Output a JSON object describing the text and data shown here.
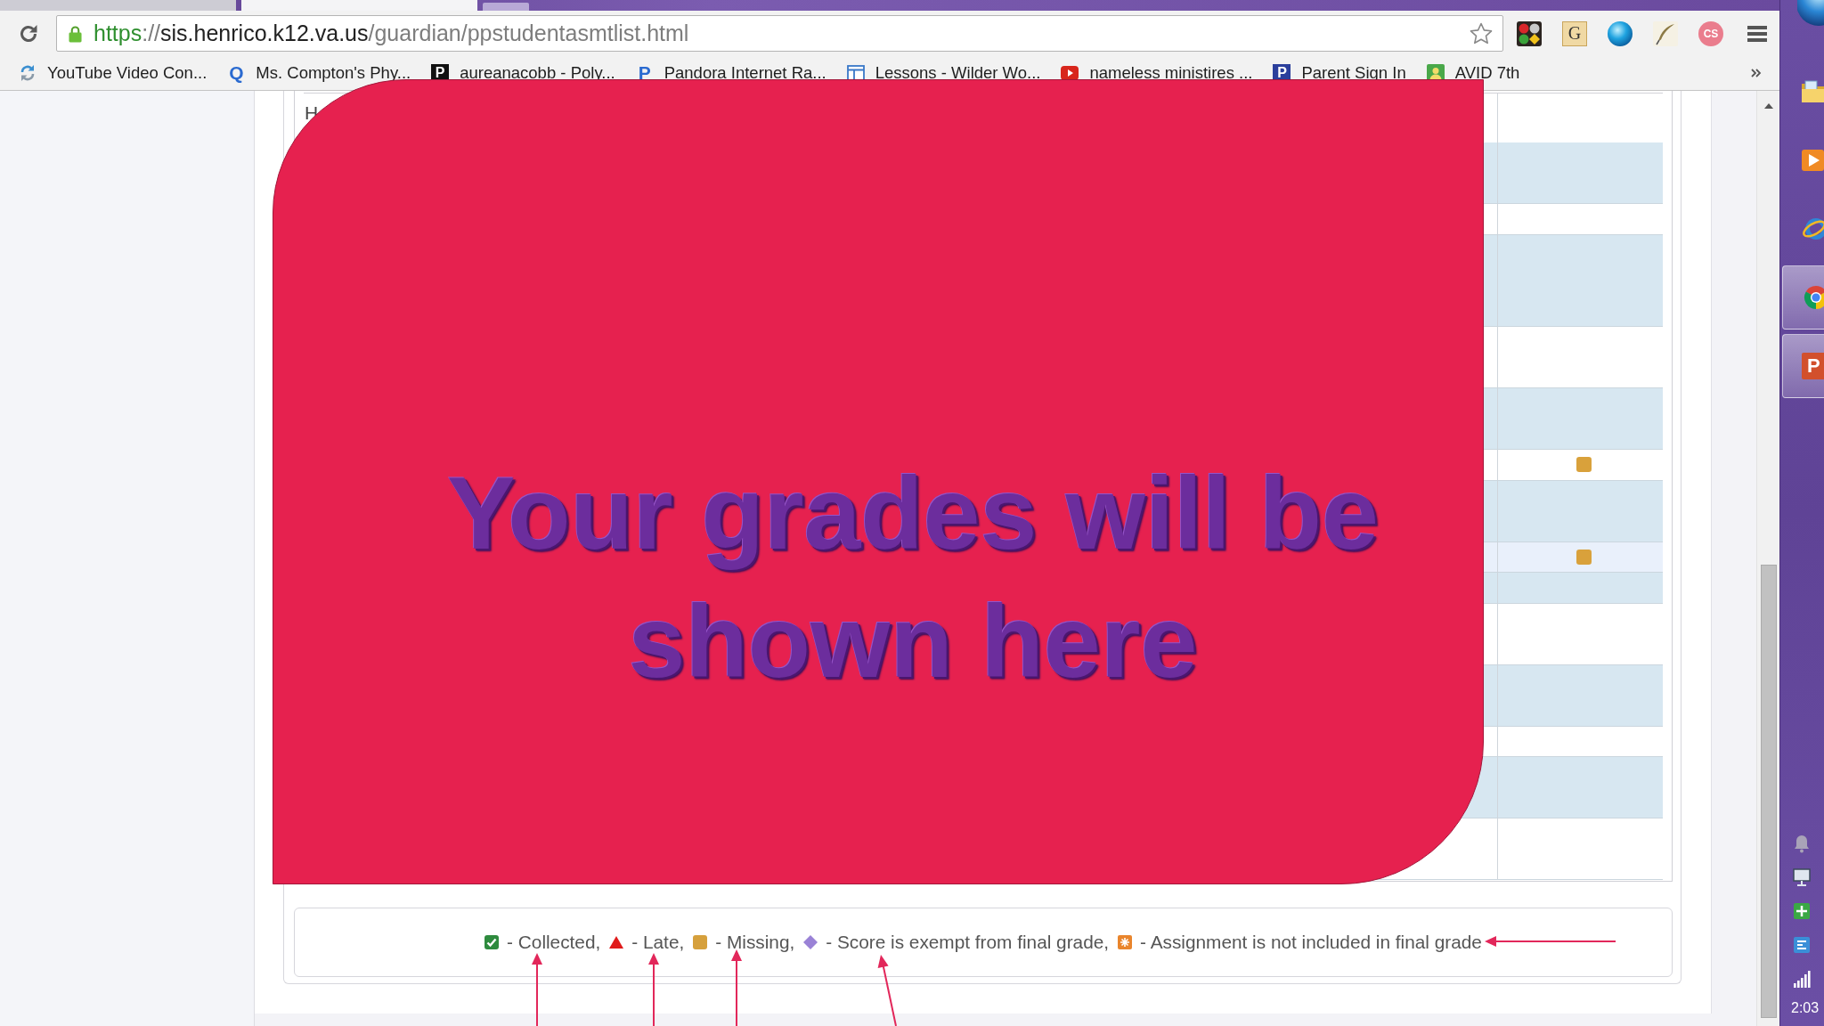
{
  "browser": {
    "tabs": [
      {
        "selected": false
      },
      {
        "selected": true
      }
    ],
    "address": {
      "scheme": "https",
      "separator": "://",
      "host": "sis.henrico.k12.va.us",
      "path": "/guardian/ppstudentasmtlist.html"
    },
    "extensions": [
      {
        "kind": "dots"
      },
      {
        "kind": "letter_tile",
        "letter": "G"
      },
      {
        "kind": "sphere"
      },
      {
        "kind": "feather"
      },
      {
        "kind": "letter_badge",
        "letter": "CS"
      }
    ],
    "bookmarks": [
      {
        "kind": "sync",
        "label": "YouTube Video Con..."
      },
      {
        "kind": "letter",
        "letter": "Q",
        "label": "Ms. Compton's Phy..."
      },
      {
        "kind": "tile",
        "letter": "P",
        "color": "#111111",
        "label": "aureanacobb - Poly..."
      },
      {
        "kind": "letter",
        "letter": "P",
        "label": "Pandora Internet Ra..."
      },
      {
        "kind": "window",
        "label": "Lessons - Wilder Wo..."
      },
      {
        "kind": "video",
        "label": "nameless ministires ..."
      },
      {
        "kind": "tile",
        "letter": "P",
        "color": "#2b3f9c",
        "label": "Parent Sign In"
      },
      {
        "kind": "person",
        "label": "AVID 7th"
      }
    ]
  },
  "page": {
    "table": {
      "columns": [
        "H"
      ],
      "rows": [
        {
          "missing": false,
          "highlighted": false
        },
        {
          "missing": false,
          "highlighted": false
        },
        {
          "missing": false,
          "highlighted": false
        },
        {
          "missing": false,
          "highlighted": false
        },
        {
          "missing": false,
          "highlighted": false
        },
        {
          "missing": true,
          "highlighted": false
        },
        {
          "missing": false,
          "highlighted": false
        },
        {
          "missing": true,
          "highlighted": true
        },
        {
          "missing": false,
          "highlighted": false
        },
        {
          "missing": false,
          "highlighted": false
        },
        {
          "missing": false,
          "highlighted": false
        },
        {
          "missing": false,
          "highlighted": false
        },
        {
          "missing": false,
          "highlighted": false
        },
        {
          "missing": false,
          "highlighted": false
        }
      ]
    },
    "legend": [
      {
        "kind": "collected",
        "label": "- Collected,"
      },
      {
        "kind": "late",
        "label": "- Late,"
      },
      {
        "kind": "missing",
        "label": "- Missing,"
      },
      {
        "kind": "exempt",
        "label": "- Score is exempt from final grade,"
      },
      {
        "kind": "excluded",
        "label": "- Assignment is not included in final grade"
      }
    ]
  },
  "overlay": {
    "text": "Your grades will be shown here"
  },
  "taskbar": {
    "apps": [
      {
        "kind": "folder",
        "active": false
      },
      {
        "kind": "media",
        "active": false
      },
      {
        "kind": "ring",
        "active": false
      },
      {
        "kind": "tricolor",
        "active": true
      },
      {
        "kind": "letter",
        "letter": "P",
        "active": true
      }
    ],
    "tray": [
      {
        "kind": "bell"
      },
      {
        "kind": "monitor"
      },
      {
        "kind": "grid"
      },
      {
        "kind": "tile"
      },
      {
        "kind": "signal"
      }
    ],
    "clock": "2:03"
  }
}
